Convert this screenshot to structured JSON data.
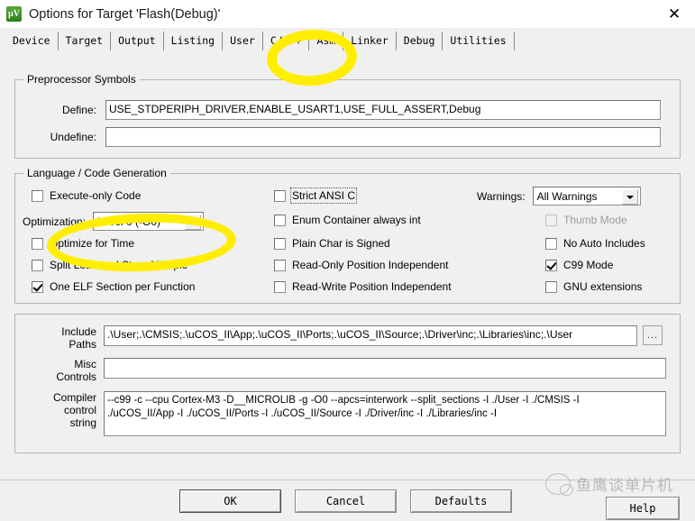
{
  "window": {
    "title": "Options for Target 'Flash(Debug)'",
    "app_icon": "uvision-icon",
    "close_label": "✕"
  },
  "tabs": [
    {
      "label": "Device",
      "selected": false
    },
    {
      "label": "Target",
      "selected": false
    },
    {
      "label": "Output",
      "selected": false
    },
    {
      "label": "Listing",
      "selected": false
    },
    {
      "label": "User",
      "selected": false
    },
    {
      "label": "C/C++",
      "selected": true
    },
    {
      "label": "Asm",
      "selected": false
    },
    {
      "label": "Linker",
      "selected": false
    },
    {
      "label": "Debug",
      "selected": false
    },
    {
      "label": "Utilities",
      "selected": false
    }
  ],
  "preprocessor": {
    "legend": "Preprocessor Symbols",
    "define_label": "Define:",
    "define_value": "USE_STDPERIPH_DRIVER,ENABLE_USART1,USE_FULL_ASSERT,Debug",
    "undefine_label": "Undefine:",
    "undefine_value": ""
  },
  "language": {
    "legend": "Language / Code Generation",
    "left_column": [
      {
        "label": "Execute-only Code",
        "checked": false,
        "enabled": true
      },
      {
        "label": "Optimize for Time",
        "checked": false,
        "enabled": true
      },
      {
        "label": "Split Load and Store Multiple",
        "checked": false,
        "enabled": true
      },
      {
        "label": "One ELF Section per Function",
        "checked": true,
        "enabled": true
      }
    ],
    "optimization_label": "Optimization:",
    "optimization_value": "Level 0 (-O0)",
    "middle_column": [
      {
        "label": "Strict ANSI C",
        "checked": false,
        "enabled": true,
        "focused": true
      },
      {
        "label": "Enum Container always int",
        "checked": false,
        "enabled": true,
        "focused": false
      },
      {
        "label": "Plain Char is Signed",
        "checked": false,
        "enabled": true,
        "focused": false
      },
      {
        "label": "Read-Only Position Independent",
        "checked": false,
        "enabled": true,
        "focused": false
      },
      {
        "label": "Read-Write Position Independent",
        "checked": false,
        "enabled": true,
        "focused": false
      }
    ],
    "warnings_label": "Warnings:",
    "warnings_value": "All Warnings",
    "right_column": [
      {
        "label": "Thumb Mode",
        "checked": false,
        "enabled": false
      },
      {
        "label": "No Auto Includes",
        "checked": false,
        "enabled": true
      },
      {
        "label": "C99 Mode",
        "checked": true,
        "enabled": true
      },
      {
        "label": "GNU extensions",
        "checked": false,
        "enabled": true
      }
    ]
  },
  "paths": {
    "include_label_line1": "Include",
    "include_label_line2": "Paths",
    "include_value": ".\\User;.\\CMSIS;.\\uCOS_II\\App;.\\uCOS_II\\Ports;.\\uCOS_II\\Source;.\\Driver\\inc;.\\Libraries\\inc;.\\User",
    "browse_label": "...",
    "misc_label_line1": "Misc",
    "misc_label_line2": "Controls",
    "misc_value": "",
    "compiler_label_line1": "Compiler",
    "compiler_label_line2": "control",
    "compiler_label_line3": "string",
    "compiler_value_line1": "--c99 -c --cpu Cortex-M3 -D__MICROLIB -g -O0 --apcs=interwork --split_sections -I ./User -I ./CMSIS -I",
    "compiler_value_line2": "./uCOS_II/App -I ./uCOS_II/Ports -I ./uCOS_II/Source -I ./Driver/inc -I ./Libraries/inc -I"
  },
  "footer": {
    "ok": "OK",
    "cancel": "Cancel",
    "defaults": "Defaults",
    "help": "Help"
  },
  "annotations": {
    "highlight_color": "#ffee00",
    "tab_circle_target": "C/C++",
    "optimization_circle_target": "Optimization: Level 0 (-O0)"
  },
  "watermark": {
    "text": "鱼鹰谈单片机",
    "logo": "wechat-icon"
  }
}
